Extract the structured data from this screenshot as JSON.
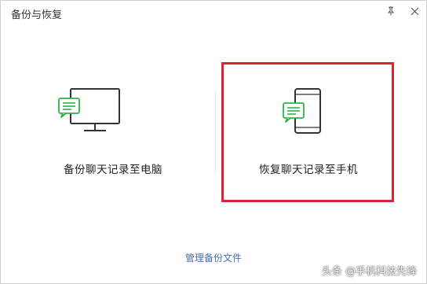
{
  "window": {
    "title": "备份与恢复"
  },
  "options": {
    "backup_label": "备份聊天记录至电脑",
    "restore_label": "恢复聊天记录至手机"
  },
  "footer": {
    "manage_label": "管理备份文件"
  },
  "watermark": {
    "text": "头条 @手机科技先锋"
  },
  "colors": {
    "accent_green": "#2fb24a",
    "highlight_red": "#d7262f",
    "link_blue": "#4a6fa5",
    "icon_stroke": "#333333"
  },
  "icons": {
    "pin": "pin-icon",
    "close": "close-icon",
    "monitor": "monitor-icon",
    "phone": "phone-icon",
    "chat_bubble": "chat-bubble-icon"
  }
}
